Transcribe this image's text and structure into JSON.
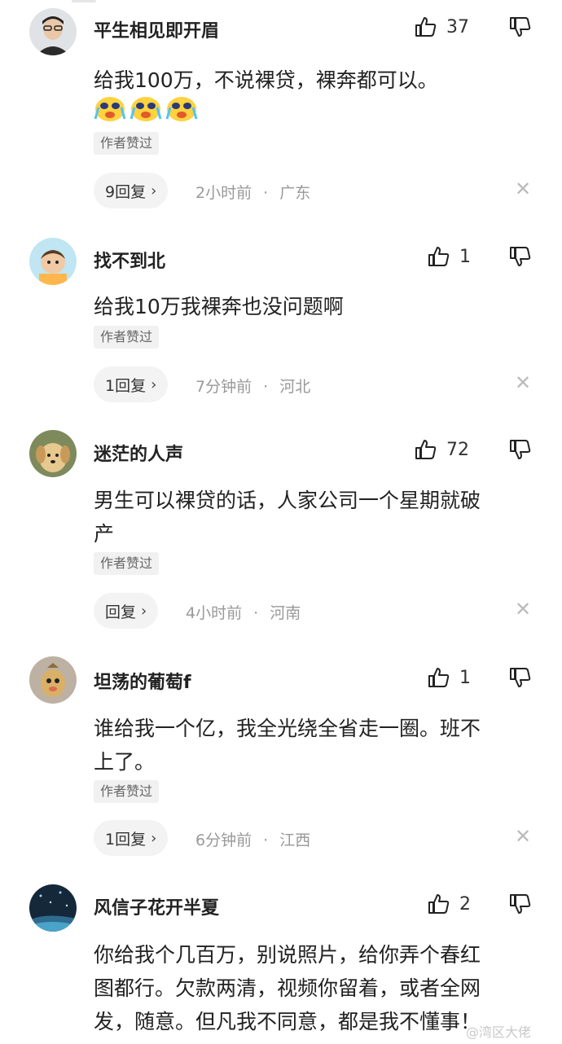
{
  "comments": [
    {
      "username": "平生相见即开眉",
      "likes": "37",
      "text": "给我100万，不说裸贷，裸奔都可以。",
      "emoji_count": 3,
      "badge": "作者赞过",
      "reply_label": "9回复",
      "time": "2小时前",
      "dot": "·",
      "location": "广东"
    },
    {
      "username": "找不到北",
      "likes": "1",
      "text": "给我10万我裸奔也没问题啊",
      "badge": "作者赞过",
      "reply_label": "1回复",
      "time": "7分钟前",
      "dot": "·",
      "location": "河北"
    },
    {
      "username": "迷茫的人声",
      "likes": "72",
      "text_lines": [
        "男生可以裸贷的话，人家公司一个星期就破",
        "产"
      ],
      "badge": "作者赞过",
      "reply_label": "回复",
      "time": "4小时前",
      "dot": "·",
      "location": "河南"
    },
    {
      "username": "坦荡的葡萄f",
      "likes": "1",
      "text_lines": [
        "谁给我一个亿，我全光绕全省走一圈。班不",
        "上了。"
      ],
      "badge": "作者赞过",
      "reply_label": "1回复",
      "time": "6分钟前",
      "dot": "·",
      "location": "江西"
    },
    {
      "username": "风信子花开半夏",
      "likes": "2",
      "text_lines": [
        "你给我个几百万，别说照片，给你弄个春红",
        "图都行。欠款两清，视频你留着，或者全网",
        "发，随意。但凡我不同意，都是我不懂事！"
      ]
    }
  ],
  "icons": {
    "like": "thumbs-up-outline-icon",
    "dislike": "thumbs-down-outline-icon",
    "close": "close-icon",
    "chevron": "chevron-right-icon"
  },
  "watermark": "@湾区大佬",
  "colors": {
    "badge_bg": "#f1f1f1",
    "reply_bg": "#f3f3f3",
    "meta_text": "#999999"
  }
}
